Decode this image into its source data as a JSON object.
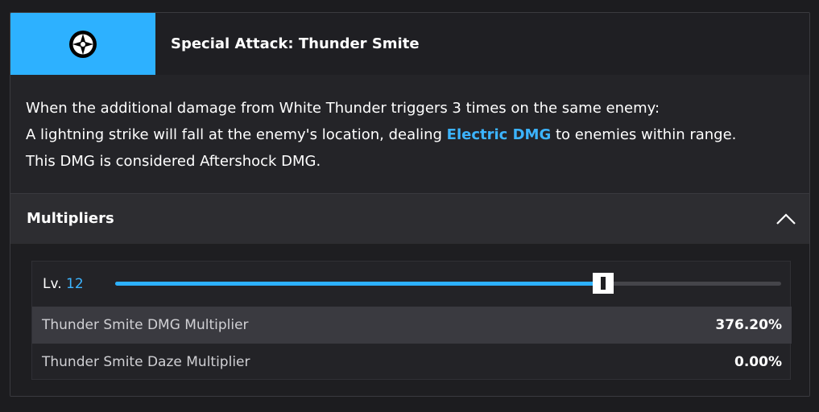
{
  "skill": {
    "icon": "special-attack-compass-icon",
    "title": "Special Attack: Thunder Smite",
    "accent_color": "#2db1ff"
  },
  "description": {
    "line1": "When the additional damage from White Thunder triggers 3 times on the same enemy:",
    "line2_pre": "A lightning strike will fall at the enemy's location, dealing ",
    "line2_highlight": "Electric DMG",
    "line2_post": " to enemies within range.",
    "line3": "This DMG is considered Aftershock DMG.",
    "highlight_color": "#3cb4ff"
  },
  "multipliers": {
    "title": "Multipliers",
    "expanded": true,
    "level_label": "Lv.",
    "level_value": "12",
    "level_current": 12,
    "level_max": 16,
    "stats": [
      {
        "name": "Thunder Smite DMG Multiplier",
        "value": "376.20%"
      },
      {
        "name": "Thunder Smite Daze Multiplier",
        "value": "0.00%"
      }
    ]
  }
}
